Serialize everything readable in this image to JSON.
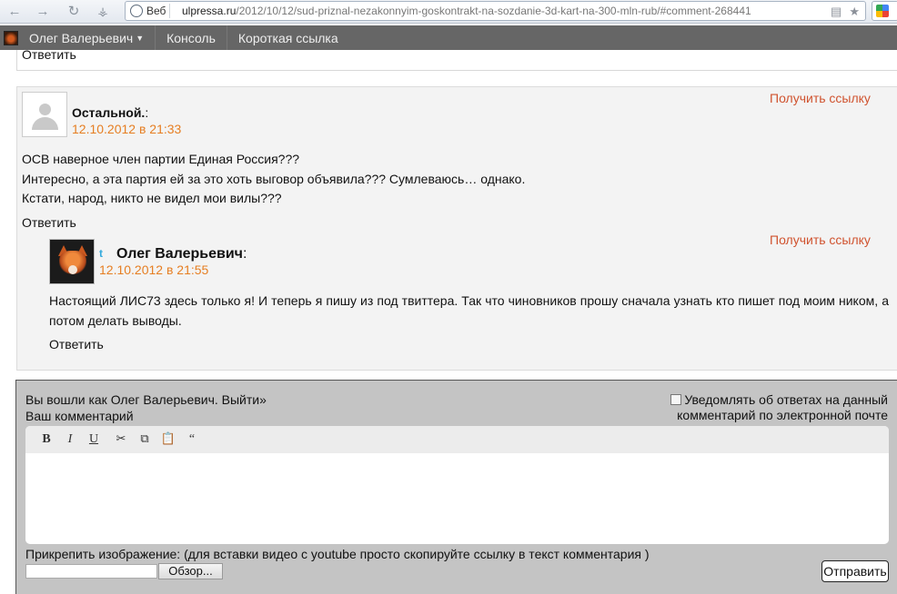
{
  "browser": {
    "web_label": "Веб",
    "url_domain": "ulpressa.ru",
    "url_path": "/2012/10/12/sud-priznal-nezakonnyim-goskontrakt-na-sozdanie-3d-kart-na-300-mln-rub/#comment-268441"
  },
  "adminbar": {
    "user_label": "Олег Валерьевич",
    "console_label": "Консоль",
    "shortlink_label": "Короткая ссылка"
  },
  "prev_reply_label": "Ответить",
  "comment": {
    "author": "Остальной.",
    "colon": ":",
    "date": "12.10.2012 в 21:33",
    "link_label": "Получить ссылку",
    "lines": [
      "ОСВ наверное член партии Единая Россия???",
      "Интересно, а эта партия ей за это хоть выговор объявила??? Сумлеваюсь… однако.",
      "Кстати, народ, никто не видел мои вилы???"
    ],
    "reply_label": "Ответить"
  },
  "subcomment": {
    "author": "Олег Валерьевич",
    "colon": ":",
    "date": "12.10.2012 в 21:55",
    "link_label": "Получить ссылку",
    "text": "Настоящий ЛИС73 здесь только я! И теперь я пишу из под твиттера.  Так что чиновников прошу сначала узнать кто пишет под моим ником, а потом делать выводы.",
    "reply_label": "Ответить"
  },
  "form": {
    "logged_in_text": "Вы вошли как Олег Валерьевич. Выйти»",
    "comment_label": "Ваш комментарий",
    "notify_line1": "Уведомлять об ответах на данный",
    "notify_line2": "комментарий по электронной почте",
    "toolbar": {
      "bold": "B",
      "italic": "I",
      "underline": "U",
      "quote": "“"
    },
    "attach_label": "Прикрепить изображение: (для вставки видео с youtube просто скопируйте ссылку в текст комментария )",
    "browse_label": "Обзор...",
    "submit_label": "Отправить"
  }
}
